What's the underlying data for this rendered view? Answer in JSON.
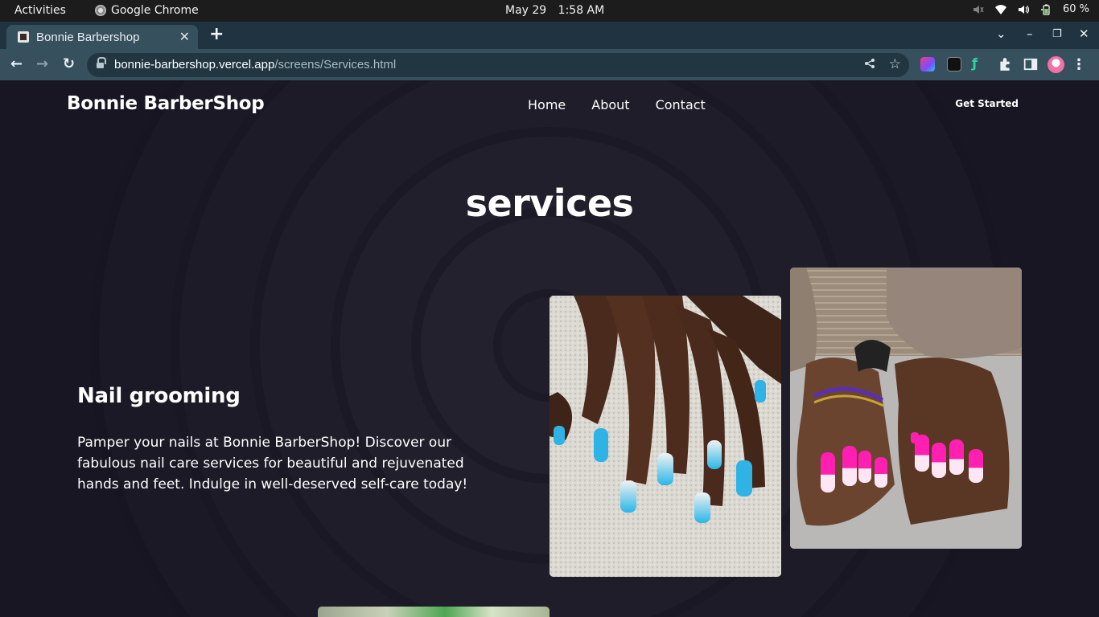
{
  "os_bar": {
    "activities": "Activities",
    "app_name": "Google Chrome",
    "date": "May 29",
    "time": "1:58 AM",
    "battery": "60 %"
  },
  "browser": {
    "tab_title": "Bonnie Barbershop",
    "url_host": "bonnie-barbershop.vercel.app",
    "url_path": "/screens/Services.html"
  },
  "site": {
    "brand": "Bonnie BarberShop",
    "nav": [
      "Home",
      "About",
      "Contact"
    ],
    "cta": "Get Started"
  },
  "main": {
    "title": "services",
    "service": {
      "heading": "Nail grooming",
      "description": "Pamper your nails at Bonnie BarberShop! Discover our fabulous nail care services for beautiful and rejuvenated hands and feet. Indulge in well-deserved self-care today!"
    }
  },
  "colors": {
    "tab_strip": "#1f3440",
    "toolbar": "#37505d",
    "page_background": "#15141f",
    "text": "#ffffff"
  }
}
